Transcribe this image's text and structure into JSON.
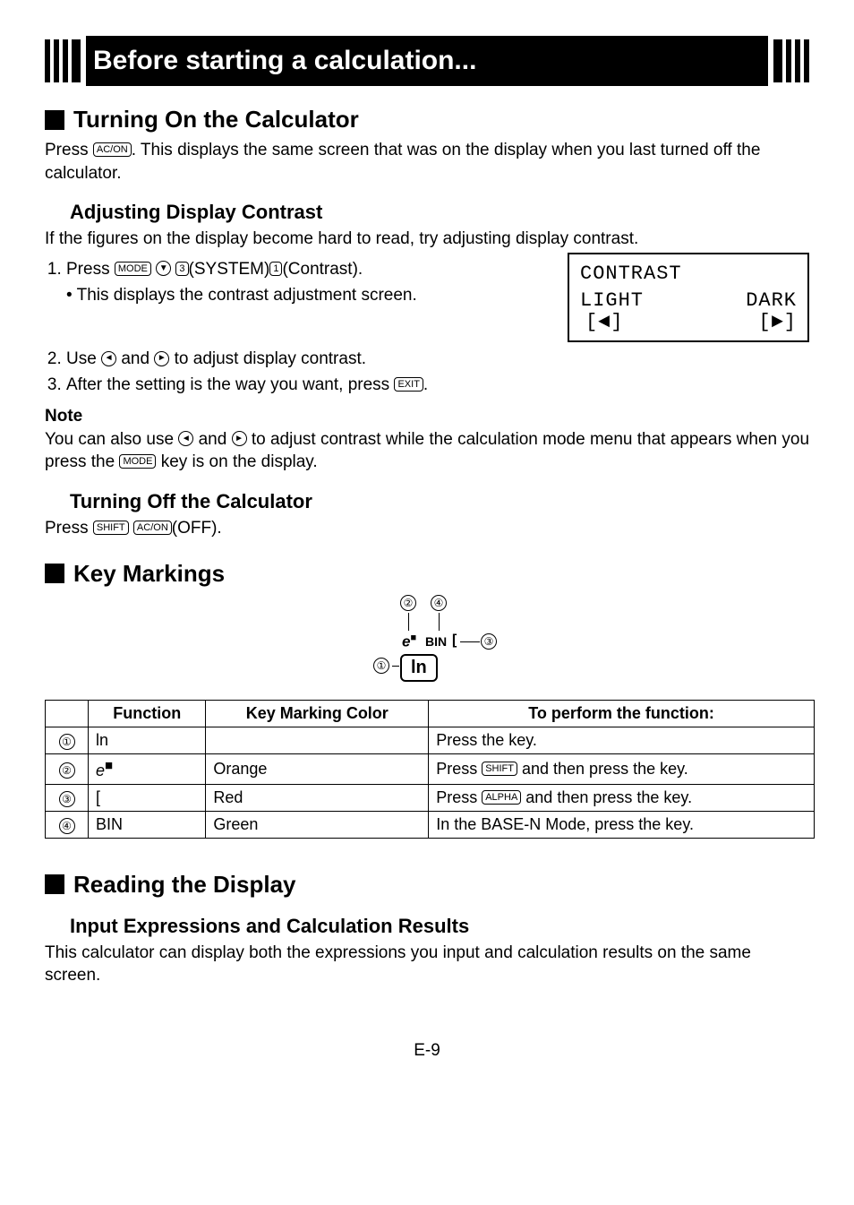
{
  "banner": {
    "title": "Before starting a calculation..."
  },
  "section1": {
    "heading": "Turning On the Calculator",
    "para1_a": "Press ",
    "para1_b": ". This displays the same screen that was on the display when you last turned off the calculator."
  },
  "contrast": {
    "heading": "Adjusting Display Contrast",
    "intro": "If the figures on the display become hard to read, try adjusting display contrast.",
    "step1_a": "Press ",
    "step1_b": "(SYSTEM)",
    "step1_c": "(Contrast).",
    "bullet": "• This displays the contrast adjustment screen.",
    "step2_a": "Use ",
    "step2_b": " and ",
    "step2_c": " to adjust display contrast.",
    "step3_a": "After the setting is the way you want, press ",
    "step3_b": ".",
    "screen": {
      "title": "CONTRAST",
      "light": "LIGHT",
      "light_arrow": "[◄]",
      "dark": "DARK",
      "dark_arrow": "[►]"
    },
    "note_label": "Note",
    "note_a": "You can also use ",
    "note_b": " and ",
    "note_c": " to adjust contrast while the calculation mode menu that appears when you press the ",
    "note_d": " key is on the display."
  },
  "turnoff": {
    "heading": "Turning Off the Calculator",
    "text_a": "Press ",
    "text_b": "(OFF)."
  },
  "keymarkings": {
    "heading": "Key Markings",
    "diagram": {
      "ln": "ln",
      "e": "e",
      "esup": "■",
      "bin": "BIN",
      "brk": "["
    }
  },
  "table": {
    "headers": {
      "c1": "",
      "c2": "Function",
      "c3": "Key Marking Color",
      "c4": "To perform the function:"
    },
    "rows": [
      {
        "num": "①",
        "func_text": "ln",
        "color": "",
        "action_a": "Press the key.",
        "action_b": ""
      },
      {
        "num": "②",
        "func_text": "e",
        "func_sup": "■",
        "color": "Orange",
        "action_a": "Press ",
        "key": "SHIFT",
        "action_b": " and then press the key."
      },
      {
        "num": "③",
        "func_text": "[",
        "color": "Red",
        "action_a": "Press ",
        "key": "ALPHA",
        "action_b": " and then press the key."
      },
      {
        "num": "④",
        "func_text": "BIN",
        "color": "Green",
        "action_a": "In the BASE-N Mode, press the key.",
        "action_b": ""
      }
    ]
  },
  "reading": {
    "heading": "Reading the Display",
    "sub": "Input Expressions and Calculation Results",
    "text": "This calculator can display both the expressions you input and calculation results on the same screen."
  },
  "footer": {
    "page": "E-9"
  },
  "keys": {
    "acon": "AC/ON",
    "mode": "MODE",
    "three": "3",
    "one": "1",
    "exit": "EXIT",
    "shift": "SHIFT",
    "alpha": "ALPHA"
  }
}
